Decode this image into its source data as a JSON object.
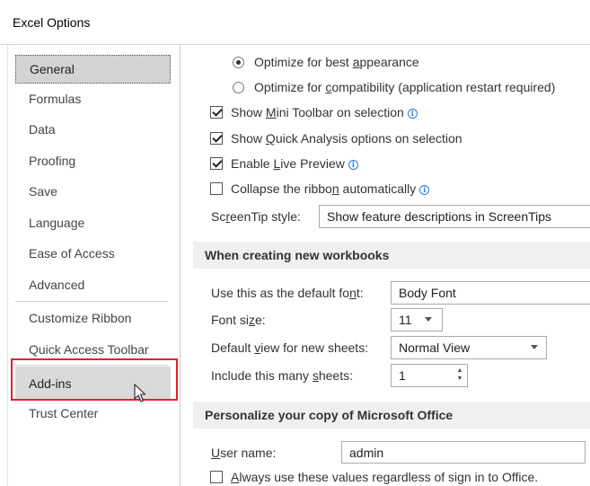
{
  "window": {
    "title": "Excel Options"
  },
  "sidebar": {
    "items": [
      {
        "label": "General"
      },
      {
        "label": "Formulas"
      },
      {
        "label": "Data"
      },
      {
        "label": "Proofing"
      },
      {
        "label": "Save"
      },
      {
        "label": "Language"
      },
      {
        "label": "Ease of Access"
      },
      {
        "label": "Advanced"
      },
      {
        "label": "Customize Ribbon"
      },
      {
        "label": "Quick Access Toolbar"
      },
      {
        "label": "Add-ins"
      },
      {
        "label": "Trust Center"
      }
    ],
    "selected": "General",
    "highlighted": "Add-ins"
  },
  "ui_options": {
    "radio_best_appearance": {
      "pre": "Optimize for best ",
      "key": "a",
      "post": "ppearance",
      "selected": true
    },
    "radio_compatibility": {
      "pre": "Optimize for ",
      "key": "c",
      "post": "ompatibility (application restart required)",
      "selected": false
    },
    "mini_toolbar": {
      "pre": "Show ",
      "key": "M",
      "post": "ini Toolbar on selection",
      "checked": true
    },
    "quick_analysis": {
      "pre": "Show ",
      "key": "Q",
      "post": "uick Analysis options on selection",
      "checked": true
    },
    "live_preview": {
      "pre": "Enable ",
      "key": "L",
      "post": "ive Preview",
      "checked": true
    },
    "collapse_ribbon": {
      "pre": "Collapse the ribbo",
      "key": "n",
      "post": " automatically",
      "checked": false
    },
    "screentip": {
      "label_pre": "Sc",
      "label_key": "r",
      "label_post": "eenTip style:",
      "value": "Show feature descriptions in ScreenTips"
    }
  },
  "new_workbooks": {
    "heading": "When creating new workbooks",
    "default_font": {
      "label_pre": "Use this as the default fo",
      "label_key": "n",
      "label_post": "t:",
      "value": "Body Font"
    },
    "font_size": {
      "label_pre": "Font si",
      "label_key": "z",
      "label_post": "e:",
      "value": "11"
    },
    "default_view": {
      "label_pre": "Default ",
      "label_key": "v",
      "label_post": "iew for new sheets:",
      "value": "Normal View"
    },
    "sheets": {
      "label_pre": "Include this many ",
      "label_key": "s",
      "label_post": "heets:",
      "value": "1"
    }
  },
  "personalize": {
    "heading": "Personalize your copy of Microsoft Office",
    "username": {
      "label_key": "U",
      "label_post": "ser name:",
      "value": "admin"
    },
    "always_use": {
      "key": "A",
      "post": "lways use these values regardless of sign in to Office.",
      "checked": false
    }
  },
  "icons": {
    "info": "info-icon",
    "cursor": "mouse-pointer-icon"
  },
  "colors": {
    "highlight_border": "#e0232b",
    "info_blue": "#2b79d6",
    "selected_bg": "#d3d3d3",
    "section_bg": "#f0f0f0"
  }
}
